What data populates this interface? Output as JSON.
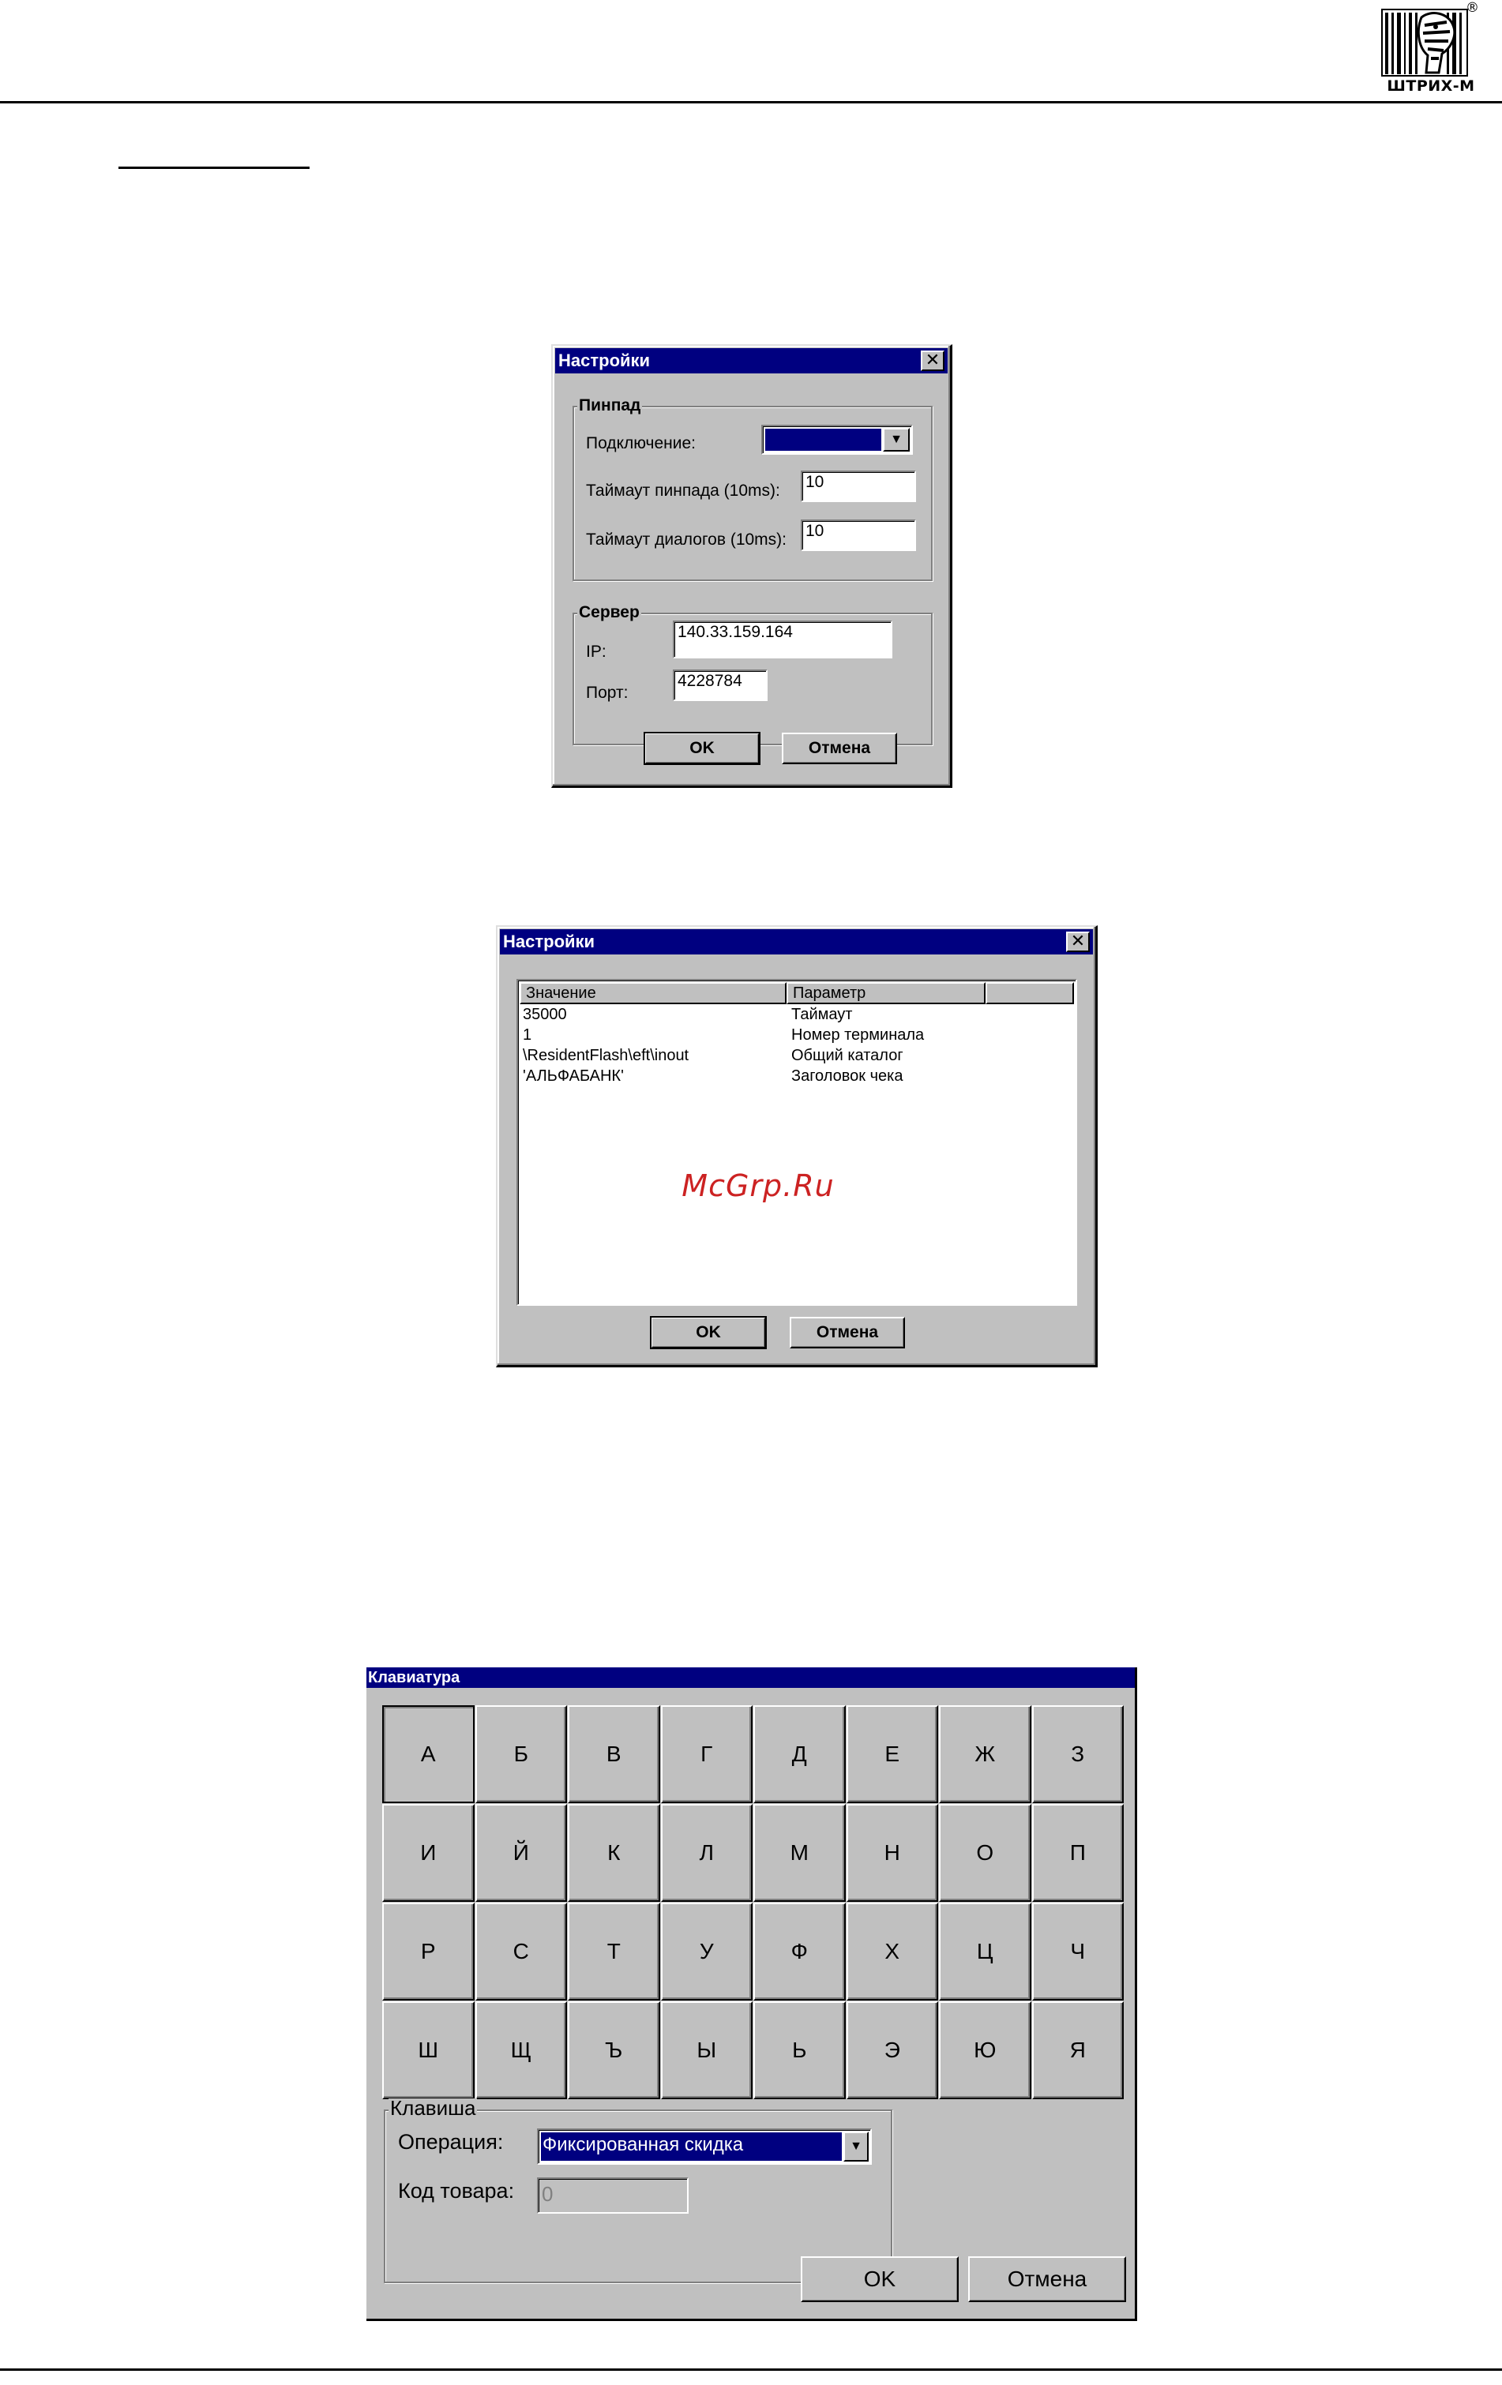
{
  "page": {
    "logo_text": "ШТРИХ-М",
    "logo_mark": "®"
  },
  "watermark": "McGrp.Ru",
  "dialog_settings_pinpad": {
    "title": "Настройки",
    "group_pinpad": "Пинпад",
    "connection_label": "Подключение:",
    "connection_value": "",
    "pinpad_timeout_label": "Таймаут пинпада (10ms):",
    "pinpad_timeout_value": "10",
    "dialog_timeout_label": "Таймаут диалогов (10ms):",
    "dialog_timeout_value": "10",
    "group_server": "Сервер",
    "ip_label": "IP:",
    "ip_value": "140.33.159.164",
    "port_label": "Порт:",
    "port_value": "4228784",
    "ok_label": "OK",
    "cancel_label": "Отмена"
  },
  "dialog_settings_params": {
    "title": "Настройки",
    "columns": [
      "Значение",
      "Параметр",
      ""
    ],
    "rows": [
      {
        "value": "35000",
        "param": "Таймаут"
      },
      {
        "value": "1",
        "param": "Номер терминала"
      },
      {
        "value": "\\ResidentFlash\\eft\\inout",
        "param": "Общий каталог"
      },
      {
        "value": "'АЛЬФАБАНК'",
        "param": "Заголовок чека"
      }
    ],
    "ok_label": "OK",
    "cancel_label": "Отмена"
  },
  "dialog_keyboard": {
    "title": "Клавиатура",
    "keys": [
      "А",
      "Б",
      "В",
      "Г",
      "Д",
      "Е",
      "Ж",
      "З",
      "И",
      "Й",
      "К",
      "Л",
      "М",
      "Н",
      "О",
      "П",
      "Р",
      "С",
      "Т",
      "У",
      "Ф",
      "Х",
      "Ц",
      "Ч",
      "Ш",
      "Щ",
      "Ъ",
      "Ы",
      "Ь",
      "Э",
      "Ю",
      "Я"
    ],
    "group_key": "Клавиша",
    "operation_label": "Операция:",
    "operation_value": "Фиксированная скидка",
    "item_code_label": "Код товара:",
    "item_code_value": "0",
    "ok_label": "OK",
    "cancel_label": "Отмена"
  },
  "colors": {
    "title_bar": "#000080",
    "face": "#c0c0c0",
    "watermark": "#cc2222"
  }
}
